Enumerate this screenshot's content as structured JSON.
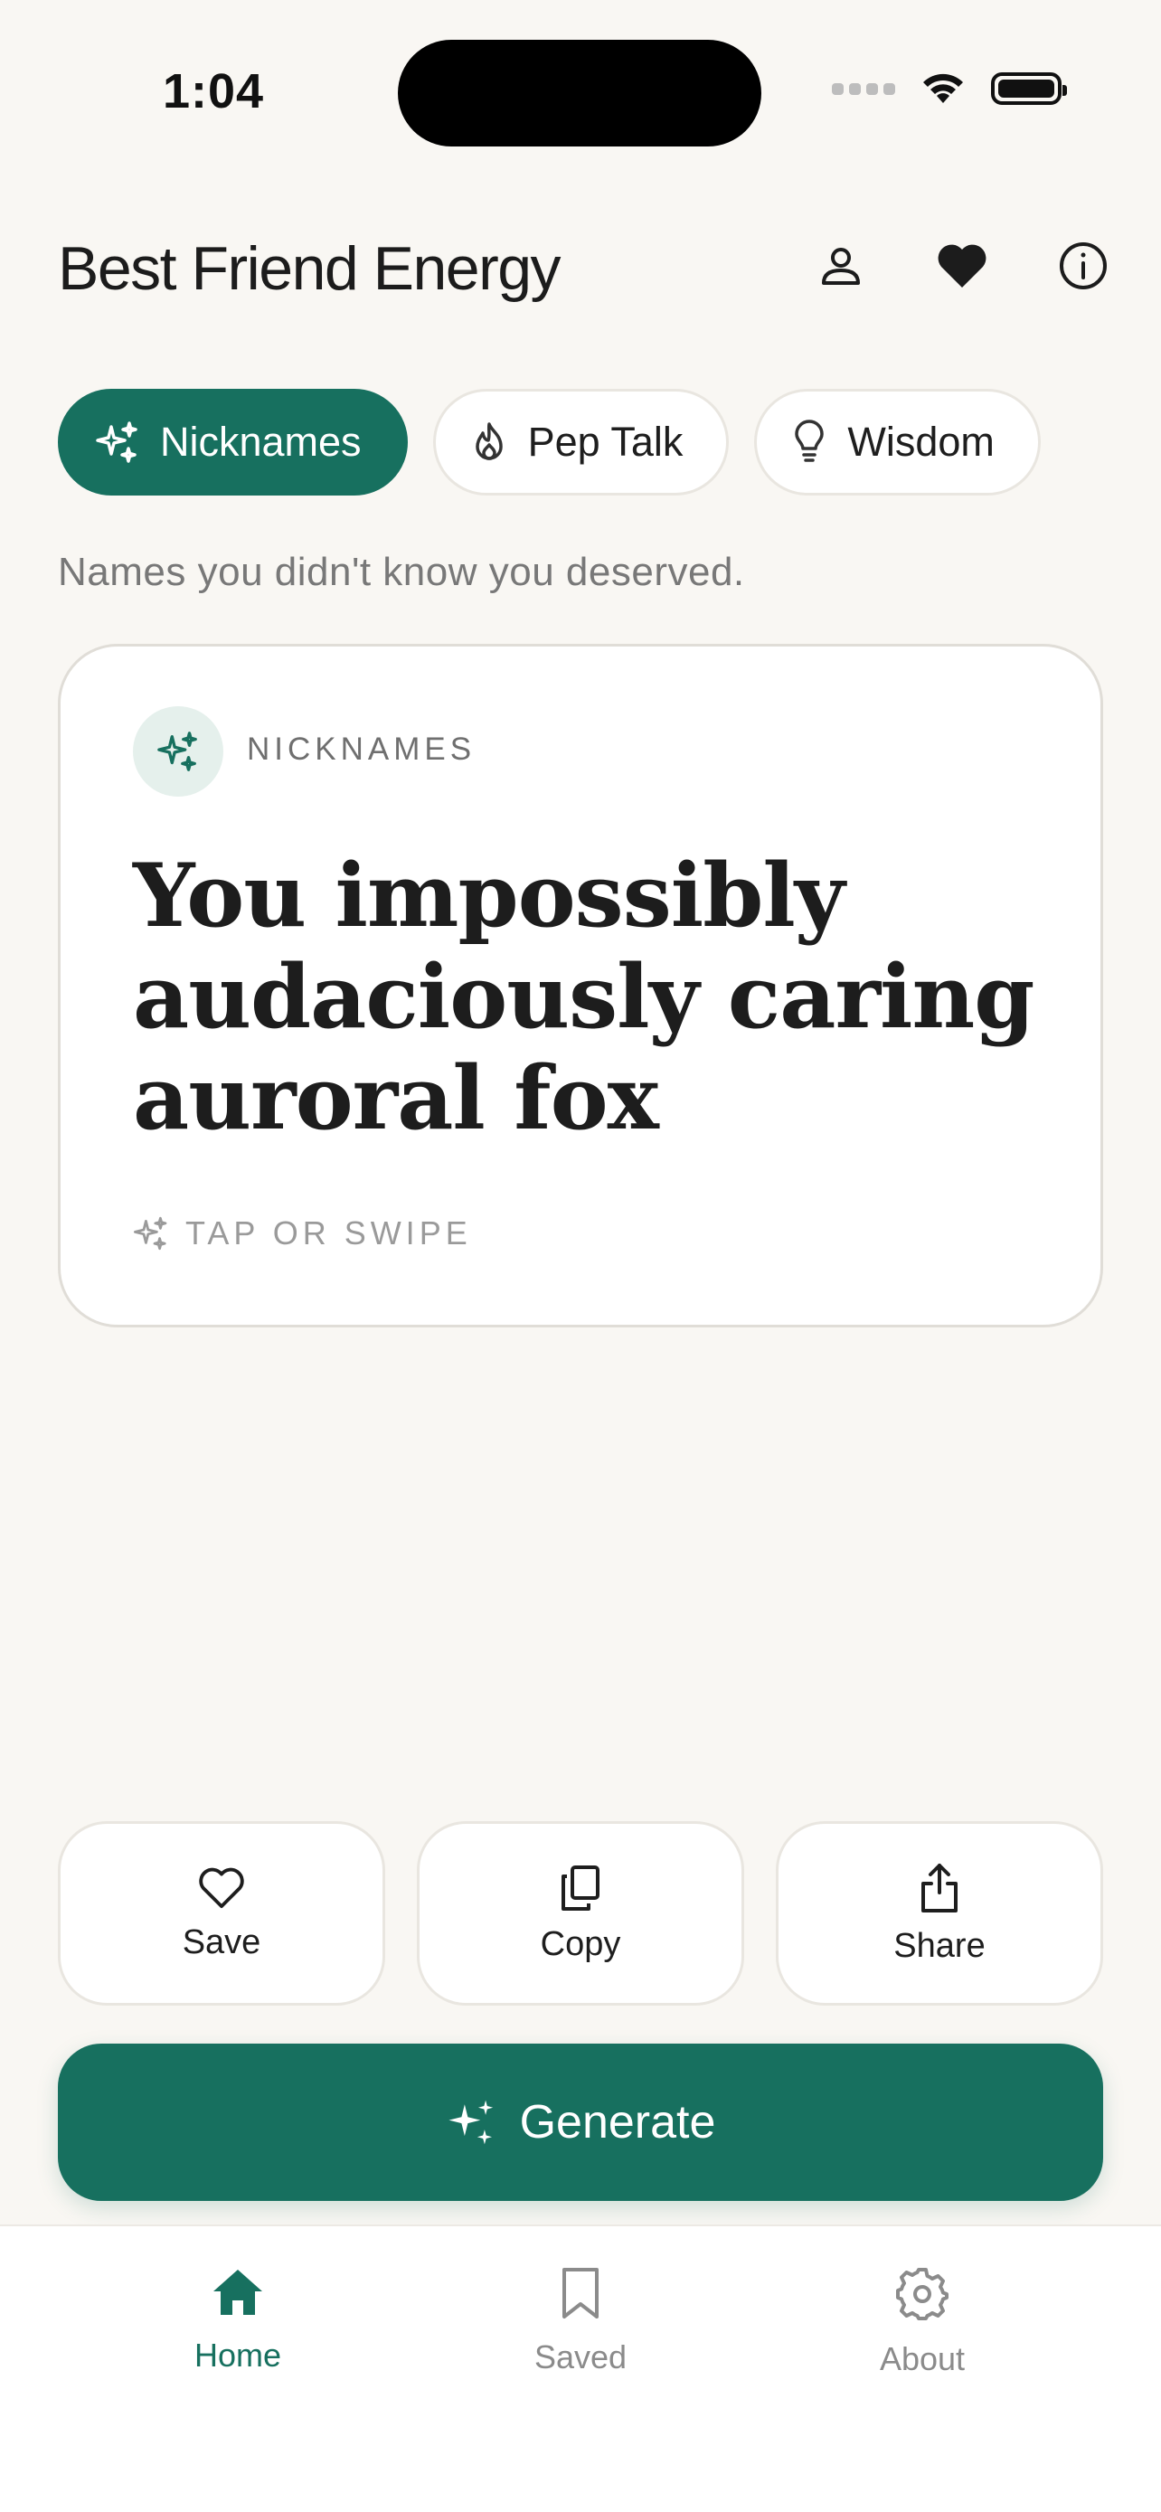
{
  "status_bar": {
    "time": "1:04"
  },
  "header": {
    "title": "Best Friend Energy",
    "icons": [
      "person-icon",
      "heart-icon",
      "info-icon"
    ]
  },
  "tabs": [
    {
      "label": "Nicknames",
      "icon": "sparkles-icon",
      "active": true
    },
    {
      "label": "Pep Talk",
      "icon": "flame-icon",
      "active": false
    },
    {
      "label": "Wisdom",
      "icon": "lightbulb-icon",
      "active": false
    }
  ],
  "subtitle": "Names you didn't know you deserved.",
  "card": {
    "category": "NICKNAMES",
    "text": "You impossibly audaciously caring auroral fox",
    "hint": "TAP OR SWIPE"
  },
  "actions": {
    "save": "Save",
    "copy": "Copy",
    "share": "Share"
  },
  "generate_label": "Generate",
  "nav": {
    "home": "Home",
    "saved": "Saved",
    "about": "About"
  },
  "colors": {
    "accent": "#17705f",
    "background": "#f9f7f3",
    "badge_bg": "#e5f0ec"
  }
}
